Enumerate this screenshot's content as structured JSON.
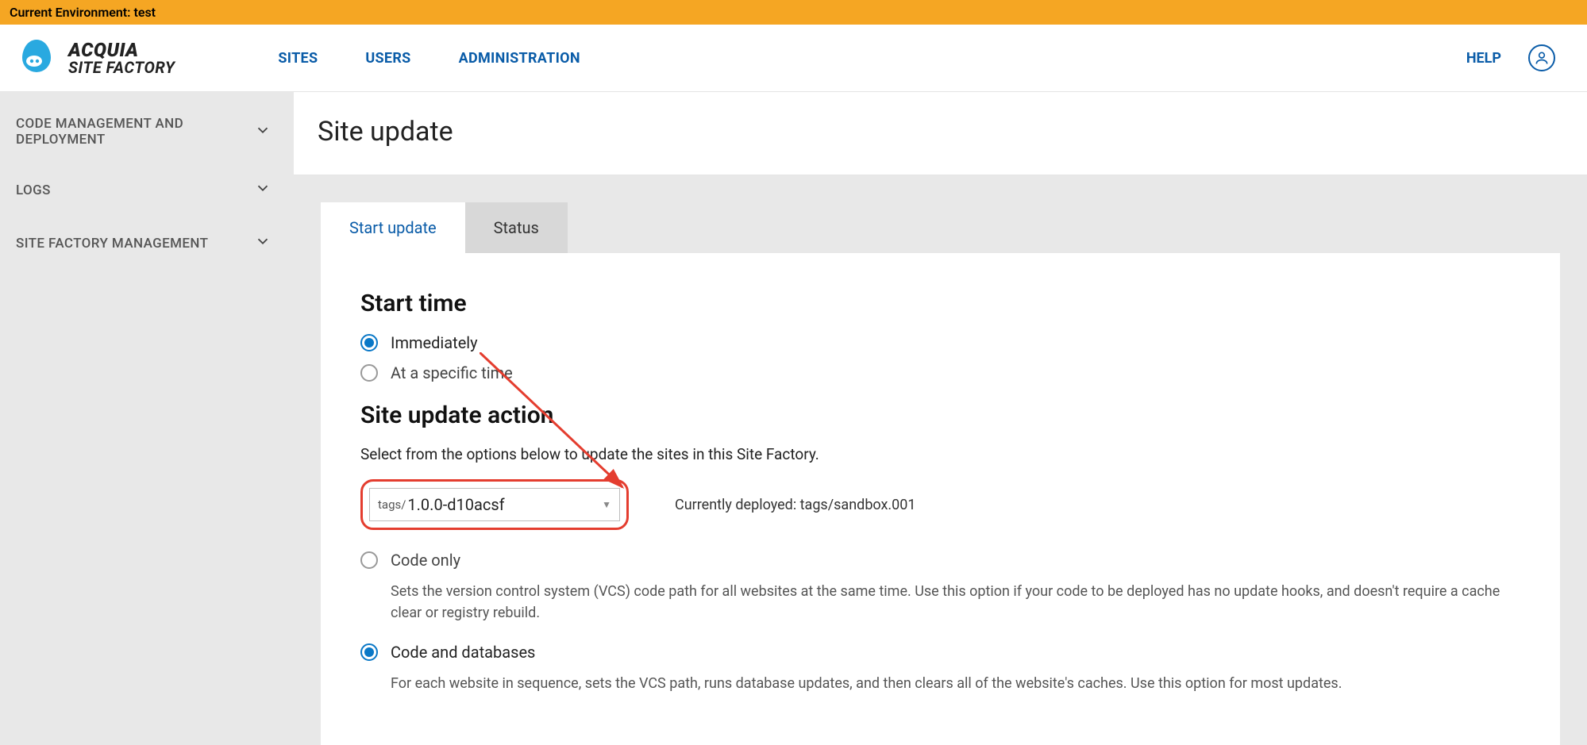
{
  "env_banner": "Current Environment: test",
  "brand": {
    "line1": "ACQUIA",
    "line2": "SITE FACTORY"
  },
  "nav": {
    "sites": "SITES",
    "users": "USERS",
    "admin": "ADMINISTRATION",
    "help": "HELP"
  },
  "sidebar": {
    "items": [
      {
        "label": "CODE MANAGEMENT AND DEPLOYMENT"
      },
      {
        "label": "LOGS"
      },
      {
        "label": "SITE FACTORY MANAGEMENT"
      }
    ]
  },
  "page": {
    "title": "Site update"
  },
  "tabs": {
    "start": "Start update",
    "status": "Status"
  },
  "form": {
    "start_time_heading": "Start time",
    "opt_immediate": "Immediately",
    "opt_specific": "At a specific time",
    "action_heading": "Site update action",
    "action_lead": "Select from the options below to update the sites in this Site Factory.",
    "tag_prefix": "tags/",
    "tag_value": "1.0.0-d10acsf",
    "deployed_label": "Currently deployed: tags/sandbox.001",
    "opt_code_only": "Code only",
    "opt_code_only_desc": "Sets the version control system (VCS) code path for all websites at the same time. Use this option if your code to be deployed has no update hooks, and doesn't require a cache clear or registry rebuild.",
    "opt_code_db": "Code and databases",
    "opt_code_db_desc": "For each website in sequence, sets the VCS path, runs database updates, and then clears all of the website's caches. Use this option for most updates."
  }
}
